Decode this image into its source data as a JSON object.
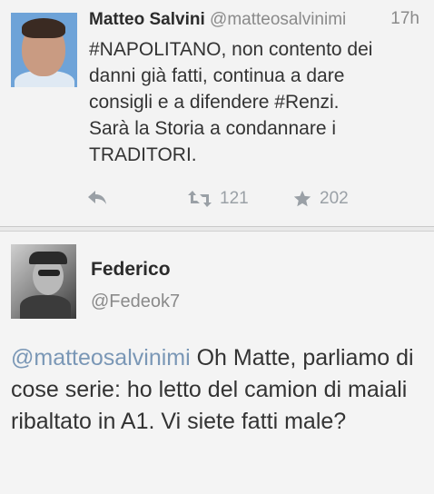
{
  "tweet1": {
    "author_name": "Matteo Salvini",
    "author_handle": "@matteosalvinimi",
    "time": "17h",
    "text_lines": [
      "#NAPOLITANO, non contento dei",
      "danni già fatti, continua a dare",
      "consigli e a difendere #Renzi.",
      "Sarà la Storia a condannare i",
      "TRADITORI."
    ],
    "retweets": "121",
    "favorites": "202"
  },
  "tweet2": {
    "author_name": "Federico",
    "author_handle": "@Fedeok7",
    "mention": "@matteosalvinimi",
    "text_rest": " Oh Matte, parliamo di cose serie: ho letto del camion di maiali ribaltato in A1. Vi siete fatti male?"
  },
  "icons": {
    "reply": "reply-icon",
    "retweet": "retweet-icon",
    "favorite": "star-icon"
  },
  "colors": {
    "mention": "#7a97b6",
    "meta": "#8a8a8a",
    "action": "#9aa0a6"
  }
}
